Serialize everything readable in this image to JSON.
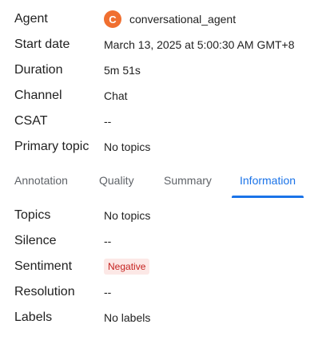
{
  "details": {
    "agent_label": "Agent",
    "agent_initial": "C",
    "agent_value": "conversational_agent",
    "start_label": "Start date",
    "start_value": "March 13, 2025 at 5:00:30 AM GMT+8",
    "duration_label": "Duration",
    "duration_value": "5m 51s",
    "channel_label": "Channel",
    "channel_value": "Chat",
    "csat_label": "CSAT",
    "csat_value": "--",
    "topic_label": "Primary topic",
    "topic_value": "No topics"
  },
  "tabs": [
    {
      "label": "Annotation"
    },
    {
      "label": "Quality"
    },
    {
      "label": "Summary"
    },
    {
      "label": "Information"
    }
  ],
  "active_tab": "Information",
  "info": {
    "topics_label": "Topics",
    "topics_value": "No topics",
    "silence_label": "Silence",
    "silence_value": "--",
    "sentiment_label": "Sentiment",
    "sentiment_value": "Negative",
    "resolution_label": "Resolution",
    "resolution_value": "--",
    "labels_label": "Labels",
    "labels_value": "No labels"
  },
  "colors": {
    "avatar": "#f06f30",
    "accent": "#1a73e8",
    "negative_bg": "#fce8e6",
    "negative_text": "#c5221f"
  }
}
